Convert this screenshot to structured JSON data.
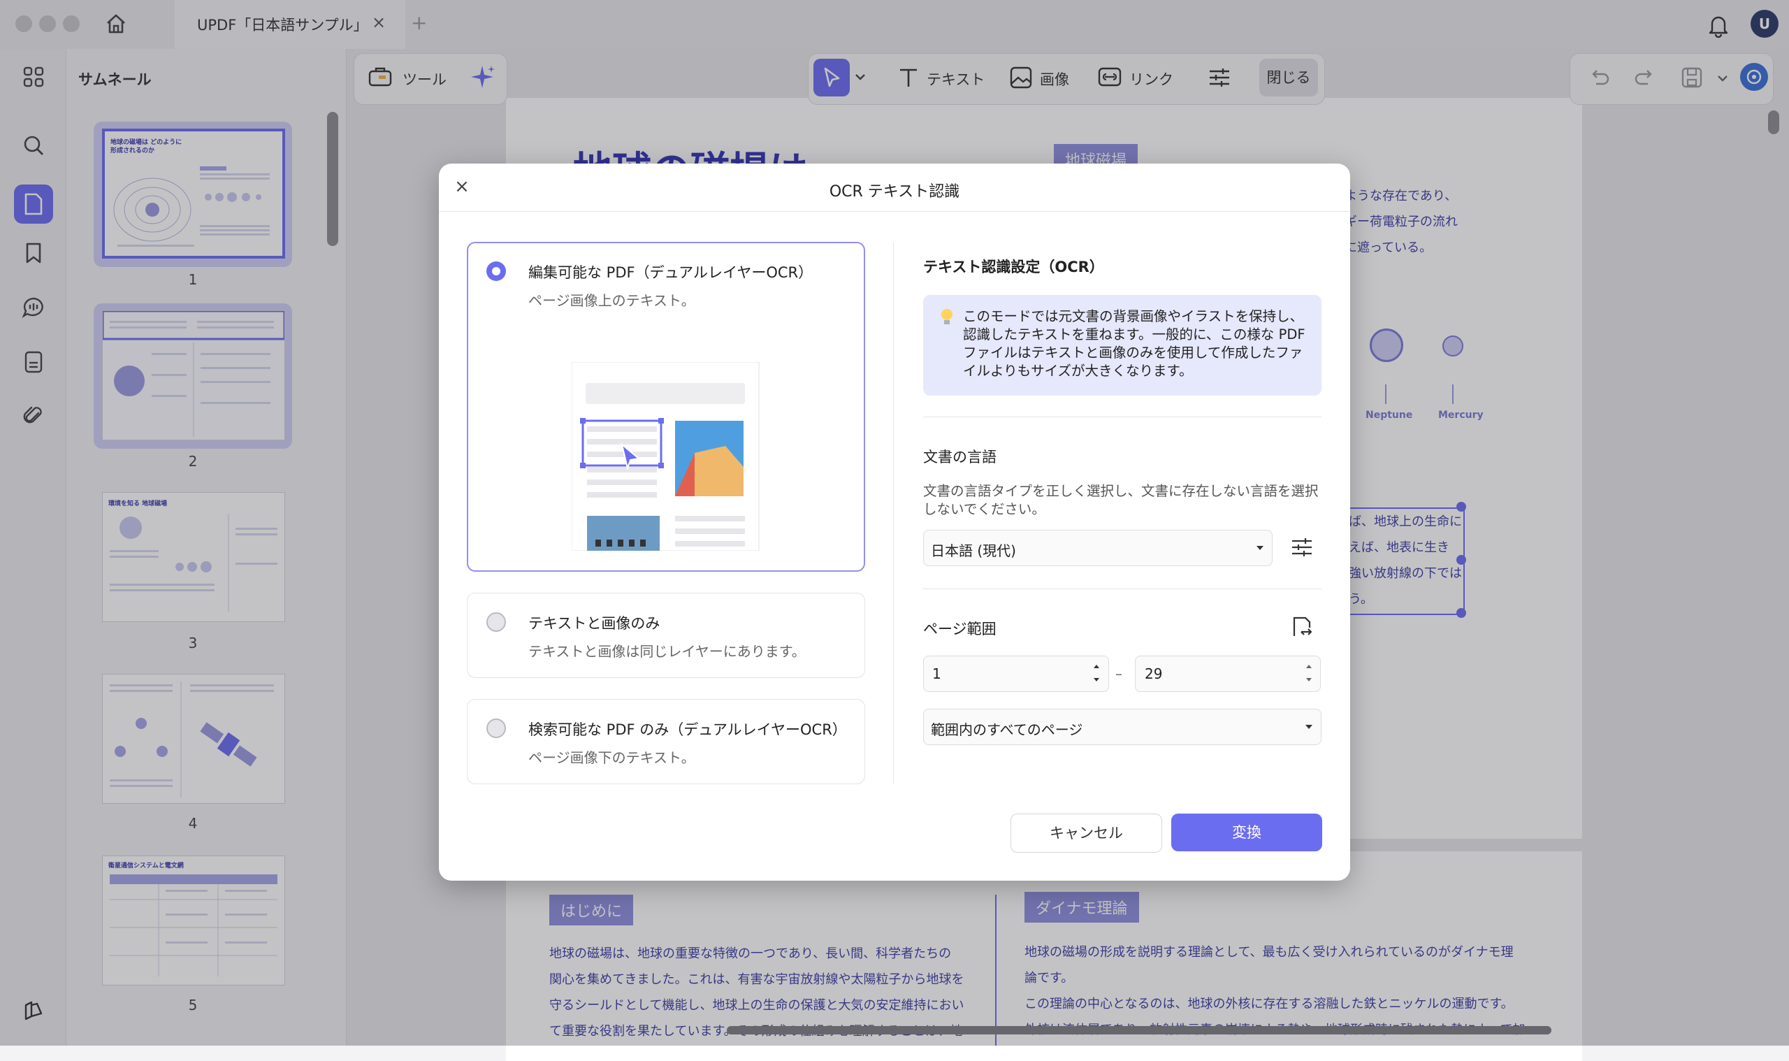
{
  "window": {
    "tab_title": "UPDF「日本語サンプル」",
    "tab_close": "×",
    "tab_add": "+",
    "user_initial": "U"
  },
  "sidebar": {
    "title": "サムネール",
    "icons": [
      "grid-icon",
      "search-icon",
      "page-icon",
      "bookmark-icon",
      "comment-icon",
      "form-icon",
      "attachment-icon",
      "sidebar-toggle-icon"
    ],
    "thumbnails": [
      {
        "page": "1",
        "title": "地球の磁場は どのように形成されるのか"
      },
      {
        "page": "2",
        "title": ""
      },
      {
        "page": "3",
        "title": "環境を知る 地球磁場"
      },
      {
        "page": "4",
        "title": ""
      },
      {
        "page": "5",
        "title": "衛星通信システムと電文網"
      }
    ]
  },
  "toolbar": {
    "tool_label": "ツール",
    "text_label": "テキスト",
    "image_label": "画像",
    "link_label": "リンク",
    "close_label": "閉じる"
  },
  "document": {
    "heading": "地球の磁場は",
    "badge_top": "地球磁場",
    "right_lines": [
      "ような存在であり、",
      "ギー荷電粒子の流れ",
      "に遮っている。"
    ],
    "planets": [
      "Neptune",
      "Mercury"
    ],
    "boxed_lines": [
      "ば、地球上の生命に",
      "えば、地表に生き",
      "強い放射線の下では",
      "う。"
    ],
    "section1_badge": "はじめに",
    "section1_lines": [
      "地球の磁場は、地球の重要な特徴の一つであり、長い間、科学者たちの",
      "関心を集めてきました。これは、有害な宇宙放射線や太陽粒子から地球を",
      "守るシールドとして機能し、地球上の生命の保護と大気の安定維持におい",
      "て重要な役割を果たしています。その形成の仕組みを理解することは、地"
    ],
    "section2_badge": "ダイナモ理論",
    "section2_lines": [
      "地球の磁場の形成を説明する理論として、最も広く受け入れられているのがダイナモ理",
      "論です。",
      "この理論の中心となるのは、地球の外核に存在する溶融した鉄とニッケルの運動です。",
      "外核は流体層であり、放射性元素の崩壊による熱や、地球形成時に残された熱によって加"
    ]
  },
  "dialog": {
    "title": "OCR テキスト認識",
    "close": "×",
    "options": [
      {
        "title": "編集可能な PDF（デュアルレイヤーOCR）",
        "desc": "ページ画像上のテキスト。",
        "selected": true
      },
      {
        "title": "テキストと画像のみ",
        "desc": "テキストと画像は同じレイヤーにあります。",
        "selected": false
      },
      {
        "title": "検索可能な PDF のみ（デュアルレイヤーOCR）",
        "desc": "ページ画像下のテキスト。",
        "selected": false
      }
    ],
    "settings_title": "テキスト認識設定（OCR）",
    "info_text": "このモードでは元文書の背景画像やイラストを保持し、認識したテキストを重ねます。一般的に、この様な PDF ファイルはテキストと画像のみを使用して作成したファイルよりもサイズが大きくなります。",
    "language_title": "文書の言語",
    "language_desc": "文書の言語タイプを正しく選択し、文書に存在しない言語を選択しないでください。",
    "language_value": "日本語 (現代)",
    "page_range_title": "ページ範囲",
    "page_from": "1",
    "page_sep": "–",
    "page_to": "29",
    "range_option": "範囲内のすべてのページ",
    "cancel_label": "キャンセル",
    "convert_label": "変換"
  },
  "colors": {
    "accent": "#6b6df0",
    "info_bg": "#e6e8fb"
  }
}
